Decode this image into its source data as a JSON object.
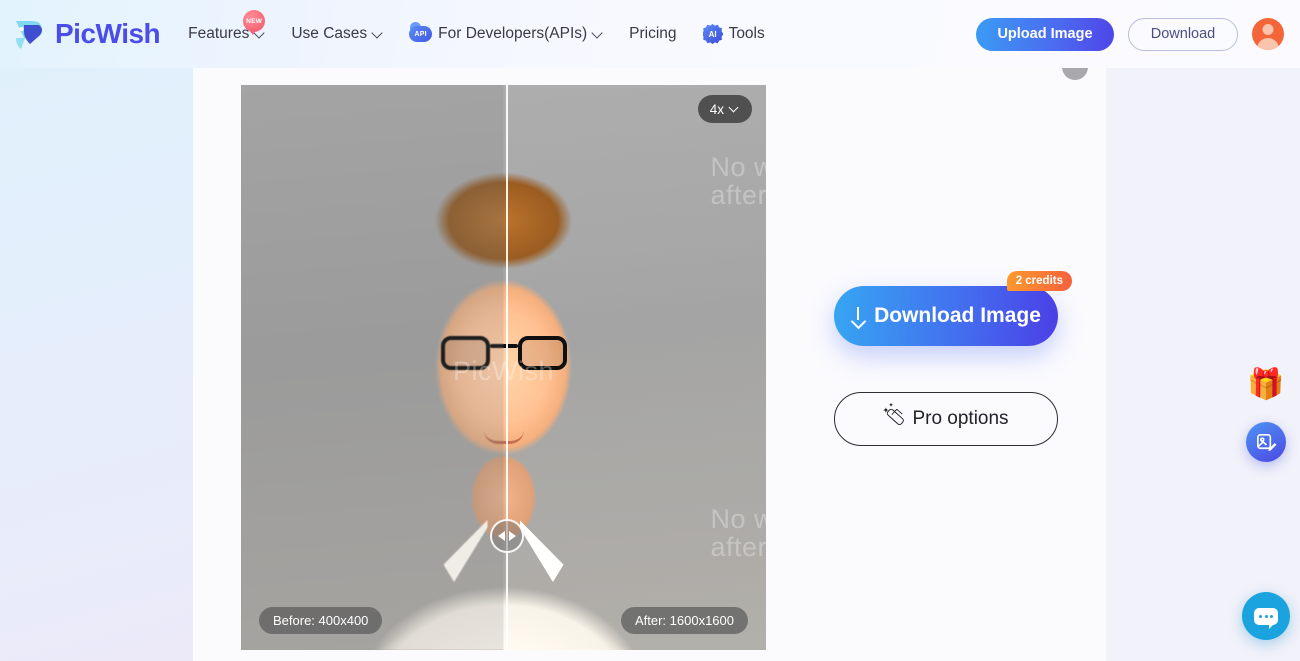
{
  "brand": {
    "name": "PicWish",
    "logo_icon": "picwish-logo-icon"
  },
  "nav": {
    "items": [
      {
        "label": "Features",
        "icon": "",
        "caret": true,
        "badge": "NEW"
      },
      {
        "label": "Use Cases",
        "icon": "",
        "caret": true,
        "badge": ""
      },
      {
        "label": "For Developers(APIs)",
        "icon": "api-icon",
        "icon_text": "API",
        "caret": true,
        "badge": ""
      },
      {
        "label": "Pricing",
        "icon": "",
        "caret": false,
        "badge": ""
      },
      {
        "label": "Tools",
        "icon": "ai-icon",
        "icon_text": "AI",
        "caret": false,
        "badge": ""
      }
    ]
  },
  "header_actions": {
    "upload_label": "Upload Image",
    "download_label": "Download",
    "avatar_icon": "user-avatar-icon"
  },
  "editor": {
    "zoom_level": "4x",
    "zoom_caret_icon": "chevron-down-icon",
    "before_tag": "Before: 400x400",
    "after_tag": "After: 1600x1600",
    "slider_icon": "left-right-arrows-icon",
    "watermarks": {
      "top_right_line1": "No w",
      "top_right_line2": "after",
      "center": "PicWish",
      "bottom_right_line1": "No w",
      "bottom_right_line2": "after"
    }
  },
  "actions": {
    "download_image_label": "Download Image",
    "download_icon": "download-arrow-icon",
    "credits_badge": "2 credits",
    "pro_options_label": "Pro options",
    "pro_icon": "magic-wand-icon"
  },
  "rail": {
    "gift_icon": "gift-box-icon",
    "gift_glyph": "🎁",
    "photo_edit_icon": "photo-edit-icon",
    "chat_icon": "chat-bubble-icon"
  },
  "colors": {
    "brand_purple": "#4b4de8",
    "gradient_start": "#36a6f2",
    "gradient_end": "#4b3fe6",
    "credits_orange": "#f5603d",
    "chat_blue": "#1ba3e0",
    "avatar_orange": "#f4663a"
  }
}
